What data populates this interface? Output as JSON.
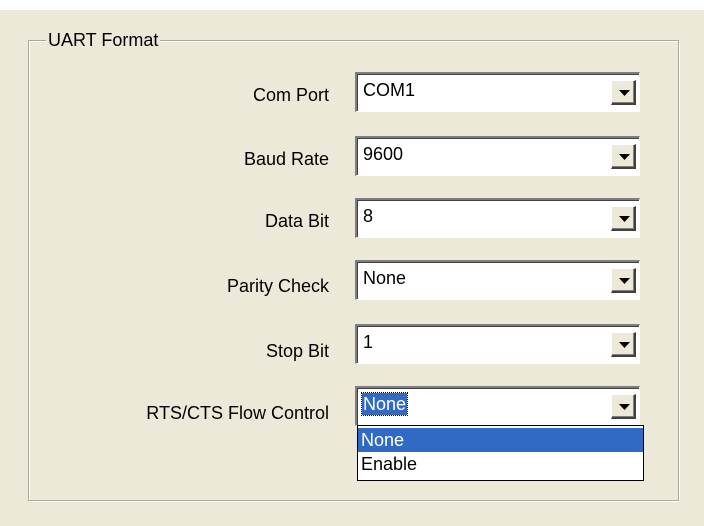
{
  "groupbox": {
    "title": "UART Format"
  },
  "fields": [
    {
      "label": "Com Port",
      "value": "COM1"
    },
    {
      "label": "Baud Rate",
      "value": "9600"
    },
    {
      "label": "Data Bit",
      "value": "8"
    },
    {
      "label": "Parity Check",
      "value": "None"
    },
    {
      "label": "Stop Bit",
      "value": "1"
    },
    {
      "label": "RTS/CTS Flow Control",
      "value": "None"
    }
  ],
  "dropdown": {
    "options": [
      "None",
      "Enable"
    ],
    "highlighted": "None"
  },
  "icons": {
    "combo_button": "chevron-down-icon"
  },
  "colors": {
    "background": "#ece9d8",
    "selection": "#316ac5",
    "field_background": "#ffffff"
  }
}
